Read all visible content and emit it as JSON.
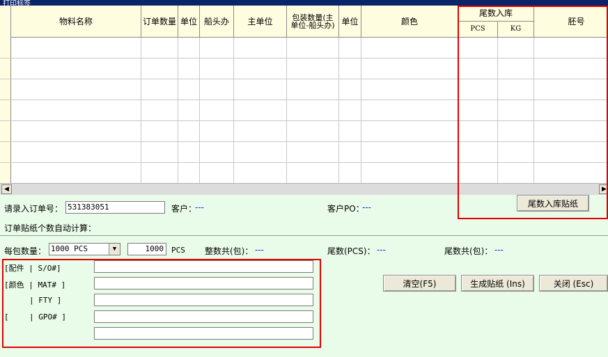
{
  "window": {
    "title": "打印标签"
  },
  "grid": {
    "headers": [
      "物料名称",
      "订单数量",
      "单位",
      "船头办",
      "主单位",
      "包装数量(主单位-船头办)",
      "单位",
      "颜色",
      "尾数入库",
      "胚号"
    ],
    "tail_sub": [
      "PCS",
      "KG"
    ]
  },
  "order": {
    "order_label": "请录入订单号：",
    "order_value": "531383051",
    "customer_label": "客户：",
    "customer_value": "---",
    "po_label": "客户PO：",
    "po_value": "---",
    "tail_btn": "尾数入库贴纸",
    "auto_calc_label": "订单贴纸个数自动计算："
  },
  "pack": {
    "per_pack_label": "每包数量：",
    "per_pack_select": "1000 PCS",
    "per_pack_input": "1000",
    "unit": "PCS",
    "whole_label": "整数共(包)：",
    "whole_value": "---",
    "tail_pcs_label": "尾数(PCS)：",
    "tail_pcs_value": "---",
    "tail_pack_label": "尾数共(包)：",
    "tail_pack_value": "---"
  },
  "labels": {
    "row1": "[配件  |  S/O#]",
    "row2": "[颜色  | MAT# ]",
    "row3": "| FTY  ]",
    "row4a": "[",
    "row4b": "| GPO# ]"
  },
  "buttons": {
    "clear": "清空(F5)",
    "generate": "生成贴纸  (Ins)",
    "close": "关闭       (Esc)"
  },
  "icons": {
    "scroll_left": "arrow-left-icon",
    "dropdown": "chevron-down-icon"
  }
}
